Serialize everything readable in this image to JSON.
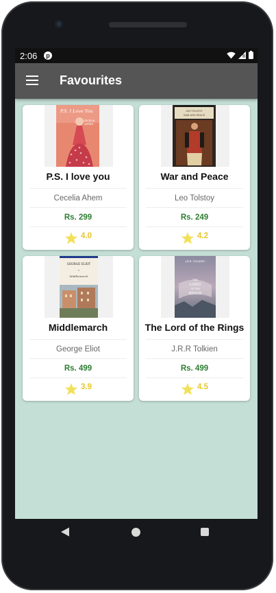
{
  "status_bar": {
    "time": "2:06",
    "app_icon": "notification-app-icon",
    "icons": [
      "wifi-icon",
      "signal-icon",
      "battery-icon"
    ]
  },
  "app_bar": {
    "title": "Favourites",
    "menu_icon": "hamburger-menu-icon"
  },
  "colors": {
    "background": "#c4dfd6",
    "app_bar": "#555555",
    "price": "#2e7d32",
    "rating": "#e6c72e",
    "star": "#f2e05a"
  },
  "books": [
    {
      "title": "P.S. I love you",
      "author": "Cecelia Ahem",
      "price": "Rs. 299",
      "rating": "4.0",
      "cover_icon": "ps-i-love-you-cover",
      "cover_text": "P.S. I Love You"
    },
    {
      "title": "War and Peace",
      "author": "Leo Tolstoy",
      "price": "Rs. 249",
      "rating": "4.2",
      "cover_icon": "war-and-peace-cover",
      "cover_text": "WAR AND PEACE"
    },
    {
      "title": "Middlemarch",
      "author": "George Eliot",
      "price": "Rs. 499",
      "rating": "3.9",
      "cover_icon": "middlemarch-cover",
      "cover_text": "GEORGE ELIOT"
    },
    {
      "title": "The Lord of the Rings",
      "author": "J.R.R Tolkien",
      "price": "Rs. 499",
      "rating": "4.5",
      "cover_icon": "lord-of-the-rings-cover",
      "cover_text": "THE LORD OF THE RINGS"
    }
  ],
  "nav_bar": {
    "icons": [
      "back-icon",
      "home-icon",
      "recents-icon"
    ]
  }
}
